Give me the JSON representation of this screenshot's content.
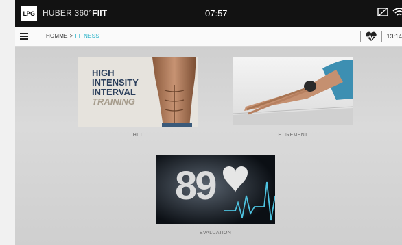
{
  "header": {
    "logo_text": "LPG",
    "brand_prefix": "HUBER 360°",
    "brand_suffix": "FIIT",
    "clock": "07:57",
    "icons": [
      "cast-icon",
      "wifi-icon"
    ]
  },
  "nav": {
    "menu_icon": "hamburger-menu-icon",
    "breadcrumb": {
      "home": "HOMME",
      "separator": ">",
      "current": "FITNESS"
    },
    "heart_icon": "heart-rate-icon",
    "time": "13:14"
  },
  "tiles": [
    {
      "id": "hiit",
      "label": "HIIT",
      "image_text": [
        "HIGH",
        "INTENSITY",
        "INTERVAL",
        "TRAINING"
      ]
    },
    {
      "id": "etirement",
      "label": "ETIREMENT"
    },
    {
      "id": "evaluation",
      "label": "EVALUATION",
      "image_text": "89"
    }
  ],
  "colors": {
    "accent": "#2bb3c9",
    "topbar": "#121212",
    "hiit_text": "#2b3f5c"
  }
}
